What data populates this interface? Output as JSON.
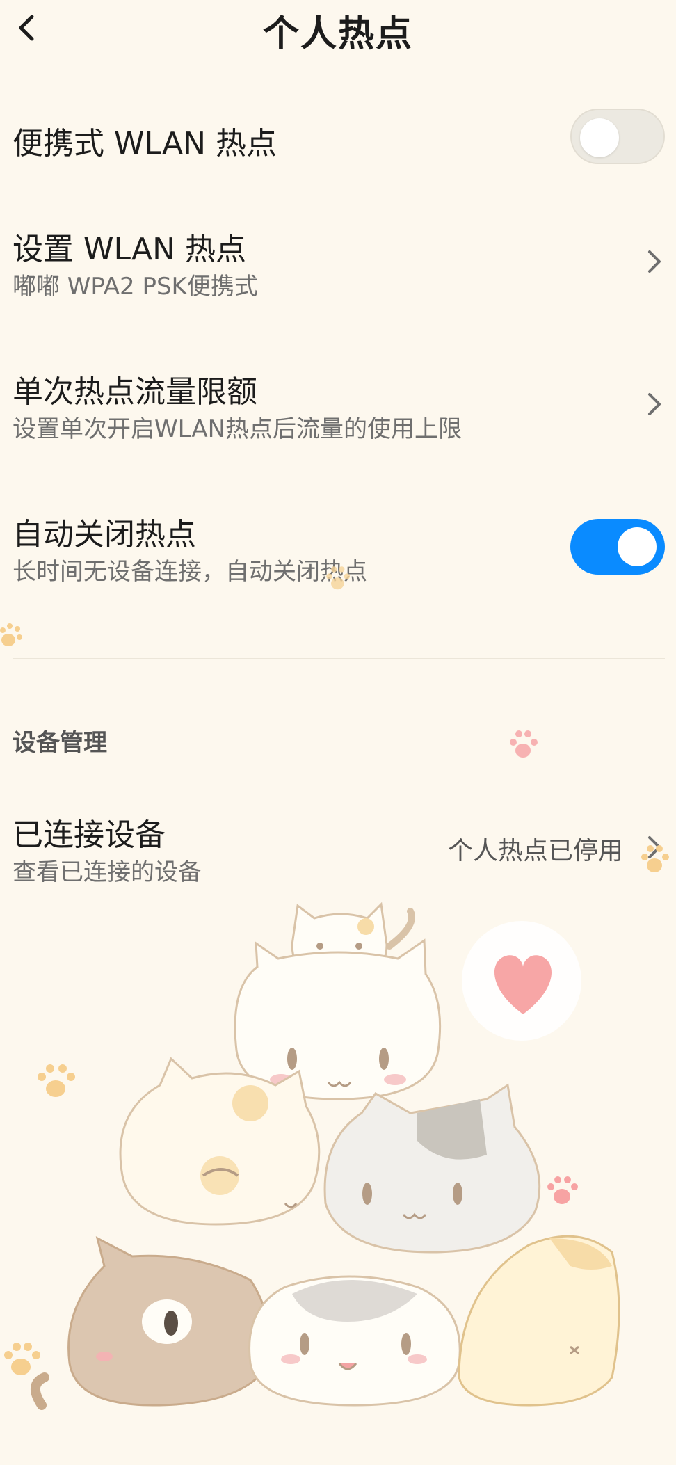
{
  "header": {
    "title": "个人热点"
  },
  "rows": {
    "portable_hotspot": {
      "title": "便携式 WLAN 热点",
      "toggle_on": false
    },
    "setup_hotspot": {
      "title": "设置 WLAN 热点",
      "subtitle": "嘟嘟 WPA2 PSK便携式"
    },
    "data_limit": {
      "title": "单次热点流量限额",
      "subtitle": "设置单次开启WLAN热点后流量的使用上限"
    },
    "auto_close": {
      "title": "自动关闭热点",
      "subtitle": "长时间无设备连接，自动关闭热点",
      "toggle_on": true
    }
  },
  "section": {
    "device_management": "设备管理"
  },
  "connected_devices": {
    "title": "已连接设备",
    "subtitle": "查看已连接的设备",
    "status": "个人热点已停用"
  },
  "icons": {
    "back": "chevron-left-icon",
    "chevron": "chevron-right-icon"
  },
  "colors": {
    "background": "#fdf8ee",
    "toggle_on": "#0a8bff",
    "toggle_off": "#ece9e1",
    "subtitle": "#6f6f6f"
  }
}
